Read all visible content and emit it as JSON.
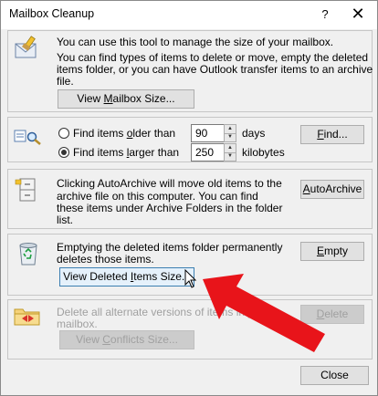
{
  "window": {
    "title": "Mailbox Cleanup",
    "help_label": "?",
    "close_glyph": "✕"
  },
  "mailbox_size": {
    "line1": "You can use this tool to manage the size of your mailbox.",
    "line2": "You can find types of items to delete or move, empty the deleted",
    "line3": "items folder, or you can have Outlook transfer items to an archive",
    "line4": "file.",
    "button_pre": "View ",
    "button_key": "M",
    "button_post": "ailbox Size..."
  },
  "find": {
    "older_pre": "Find items ",
    "older_key": "o",
    "older_post": "lder than",
    "older_value": "90",
    "older_unit": "days",
    "older_selected": false,
    "larger_pre": "Find items ",
    "larger_key": "l",
    "larger_post": "arger than",
    "larger_value": "250",
    "larger_unit": "kilobytes",
    "larger_selected": true,
    "button_key": "F",
    "button_post": "ind..."
  },
  "autoarchive": {
    "line1": "Clicking AutoArchive will move old items to the",
    "line2": "archive file on this computer. You can find",
    "line3": "these items under Archive Folders in the folder",
    "line4": "list.",
    "button_key": "A",
    "button_post": "utoArchive"
  },
  "deleted_items": {
    "line1": "Emptying the deleted items folder permanently",
    "line2": "deletes those items.",
    "empty_key": "E",
    "empty_post": "mpty",
    "view_pre": "View Deleted ",
    "view_key": "I",
    "view_post": "tems Size..."
  },
  "conflicts": {
    "line1": "Delete all alternate versions of items in your",
    "line2": "mailbox.",
    "delete_key": "D",
    "delete_post": "elete",
    "view_pre": "View ",
    "view_key": "C",
    "view_post": "onflicts Size..."
  },
  "footer": {
    "close_label": "Close"
  },
  "colors": {
    "annotation_arrow": "#e8141a"
  }
}
